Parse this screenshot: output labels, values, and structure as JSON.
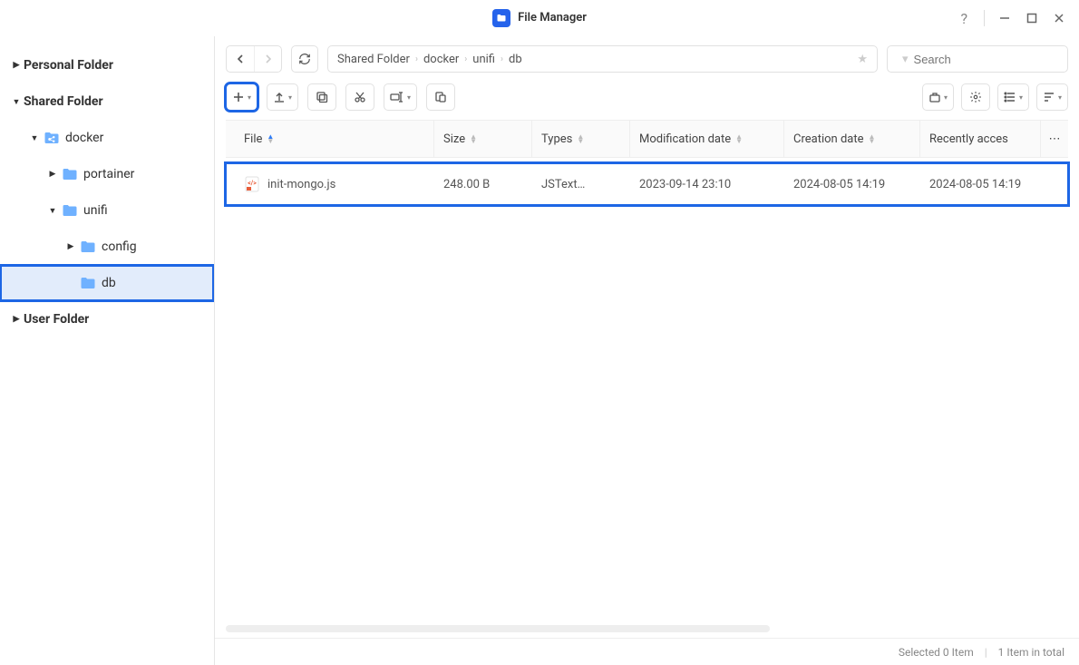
{
  "window": {
    "title": "File Manager"
  },
  "sidebar": {
    "personal": "Personal Folder",
    "shared": "Shared Folder",
    "user": "User Folder",
    "tree": {
      "docker": "docker",
      "portainer": "portainer",
      "unifi": "unifi",
      "config": "config",
      "db": "db"
    }
  },
  "breadcrumb": [
    "Shared Folder",
    "docker",
    "unifi",
    "db"
  ],
  "search": {
    "placeholder": "Search"
  },
  "columns": {
    "file": "File",
    "size": "Size",
    "types": "Types",
    "mod": "Modification date",
    "create": "Creation date",
    "recent": "Recently acces"
  },
  "rows": [
    {
      "name": "init-mongo.js",
      "size": "248.00 B",
      "type": "JSText…",
      "mod": "2023-09-14 23:10",
      "create": "2024-08-05 14:19",
      "recent": "2024-08-05 14:19"
    }
  ],
  "status": {
    "selected": "Selected 0 Item",
    "total": "1 Item in total"
  }
}
